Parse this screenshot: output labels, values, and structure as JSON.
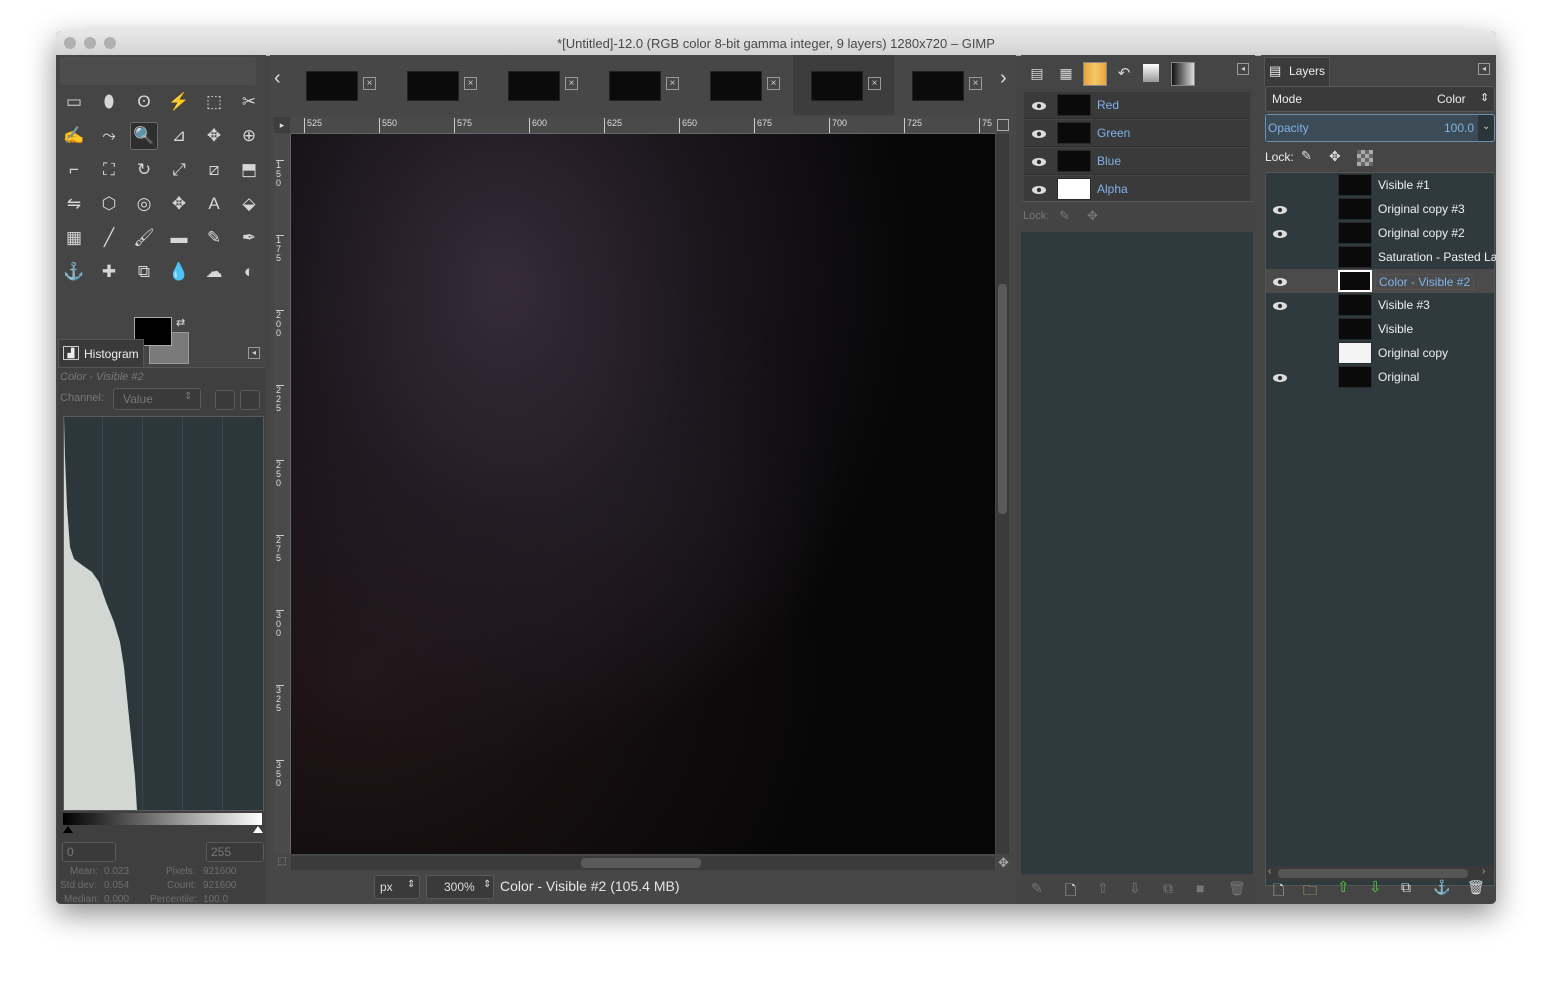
{
  "window": {
    "title": "*[Untitled]-12.0 (RGB color 8-bit gamma integer, 9 layers) 1280x720 – GIMP"
  },
  "toolbox": {
    "tools": [
      "rect-select-icon",
      "ellipse-select-icon",
      "free-select-icon",
      "fuzzy-select-icon",
      "select-by-color-icon",
      "scissors-select-icon",
      "foreground-select-icon",
      "paths-icon",
      "zoom-icon",
      "measure-icon",
      "move-icon",
      "alignment-icon",
      "crop-icon",
      "unified-transform-icon",
      "rotate-icon",
      "scale-icon",
      "shear-icon",
      "perspective-icon",
      "flip-icon",
      "cage-transform-icon",
      "warp-transform-icon",
      "handle-transform-icon",
      "text-icon",
      "bucket-fill-icon",
      "blend-icon",
      "pencil-icon",
      "paintbrush-icon",
      "eraser-icon",
      "airbrush-icon",
      "ink-icon",
      "clone-icon",
      "heal-icon",
      "perspective-clone-icon",
      "blur-icon",
      "smudge-icon",
      "dodge-burn-icon"
    ],
    "tool_glyphs": [
      "▭",
      "⬮",
      "ʘ",
      "⚡",
      "⬚",
      "✂",
      "✍",
      "⤳",
      "🔍",
      "⊿",
      "✥",
      "⊕",
      "⌐",
      "⛶",
      "↻",
      "⤢",
      "⧄",
      "⬒",
      "⇋",
      "⬡",
      "◎",
      "✥",
      "A",
      "⬙",
      "▦",
      "╱",
      "🖌",
      "▬",
      "✎",
      "✒",
      "⚓",
      "✚",
      "⧉",
      "💧",
      "☁",
      "◐"
    ],
    "fg_color": "#000000",
    "bg_color": "#7a7a7a"
  },
  "histogram": {
    "tab_label": "Histogram",
    "layer_name": "Color - Visible #2",
    "channel_label": "Channel:",
    "channel_value": "Value",
    "range_min": "0",
    "range_max": "255",
    "stats": {
      "mean_label": "Mean:",
      "mean": "0.023",
      "stddev_label": "Std dev:",
      "stddev": "0.054",
      "median_label": "Median:",
      "median": "0.000",
      "pixels_label": "Pixels:",
      "pixels": "921600",
      "count_label": "Count:",
      "count": "921600",
      "percentile_label": "Percentile:",
      "percentile": "100.0"
    }
  },
  "image_tabs": {
    "count": 7,
    "active_index": 5
  },
  "rulers": {
    "top": [
      "525",
      "550",
      "575",
      "600",
      "625",
      "650",
      "675",
      "700",
      "725",
      "75"
    ],
    "left": [
      "150",
      "175",
      "200",
      "225",
      "250",
      "275",
      "300",
      "325",
      "350"
    ]
  },
  "statusbar": {
    "unit": "px",
    "zoom": "300%",
    "info": "Color - Visible #2 (105.4 MB)"
  },
  "channels": {
    "items": [
      {
        "label": "Red"
      },
      {
        "label": "Green"
      },
      {
        "label": "Blue"
      },
      {
        "label": "Alpha"
      }
    ],
    "lock_label": "Lock:"
  },
  "layers": {
    "tab_label": "Layers",
    "mode_label": "Mode",
    "mode_value": "Color",
    "opacity_label": "Opacity",
    "opacity_value": "100.0",
    "lock_label": "Lock:",
    "items": [
      {
        "label": "Visible #1",
        "visible": false,
        "active": false,
        "white": false
      },
      {
        "label": "Original copy #3",
        "visible": true,
        "active": false,
        "white": false
      },
      {
        "label": "Original copy #2",
        "visible": true,
        "active": false,
        "white": false
      },
      {
        "label": "Saturation - Pasted La",
        "visible": false,
        "active": false,
        "white": false
      },
      {
        "label": "Color - Visible #2",
        "visible": true,
        "active": true,
        "white": false
      },
      {
        "label": "Visible #3",
        "visible": true,
        "active": false,
        "white": false
      },
      {
        "label": "Visible",
        "visible": false,
        "active": false,
        "white": false
      },
      {
        "label": "Original copy",
        "visible": false,
        "active": false,
        "white": true
      },
      {
        "label": "Original",
        "visible": true,
        "active": false,
        "white": false
      }
    ]
  }
}
